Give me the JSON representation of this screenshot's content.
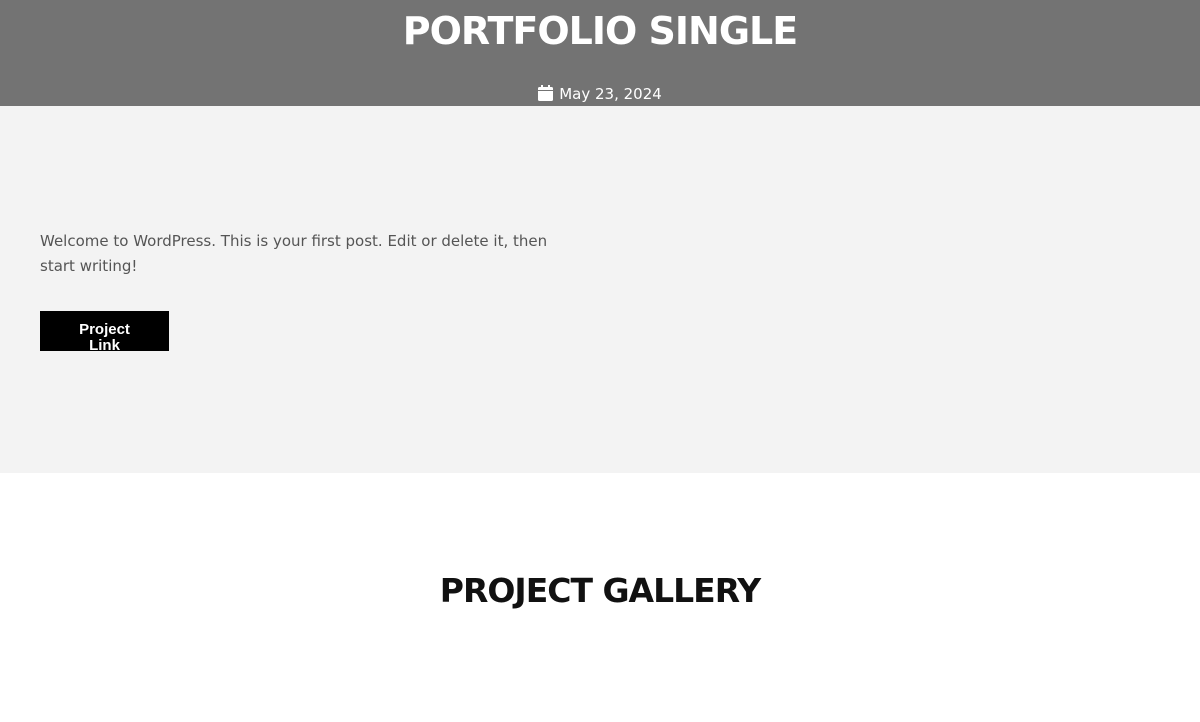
{
  "hero": {
    "title": "PORTFOLIO SINGLE",
    "date": "May 23, 2024",
    "background_color": "#737373",
    "date_icon": "calendar-icon"
  },
  "content": {
    "background_color": "#f3f3f3",
    "excerpt": "Welcome to WordPress. This is your first post. Edit or delete it, then start writing!",
    "button_label": "Project Link",
    "button_color": "#000000"
  },
  "gallery": {
    "title": "PROJECT GALLERY"
  }
}
